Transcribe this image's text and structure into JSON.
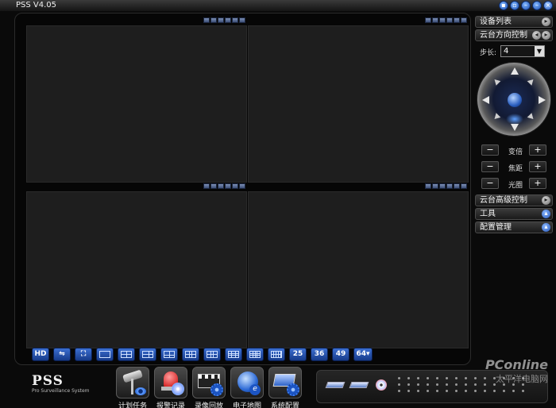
{
  "window": {
    "title": "PSS V4.05"
  },
  "layout_buttons": [
    "HD",
    "",
    "",
    "",
    "",
    "",
    "",
    "",
    "",
    "",
    "",
    "",
    "25",
    "36",
    "49",
    "64▾"
  ],
  "right_panel": {
    "device_list": "设备列表",
    "ptz_control": "云台方向控制",
    "step_label": "步长:",
    "step_value": "4",
    "adjust": [
      {
        "name": "变倍",
        "minus": "−",
        "plus": "+"
      },
      {
        "name": "焦距",
        "minus": "−",
        "plus": "+"
      },
      {
        "name": "光圈",
        "minus": "−",
        "plus": "+"
      }
    ],
    "ptz_advanced": "云台高级控制",
    "tools": "工具",
    "config_manage": "配置管理"
  },
  "logo": {
    "name": "PSS",
    "subtitle": "Pro Surveillance System"
  },
  "bottom_tools": [
    {
      "label": "计划任务",
      "icon": "camera-schedule-icon"
    },
    {
      "label": "报警记录",
      "icon": "alarm-siren-icon"
    },
    {
      "label": "录像回放",
      "icon": "video-playback-icon"
    },
    {
      "label": "电子地图",
      "icon": "emap-globe-icon"
    },
    {
      "label": "系统配置",
      "icon": "system-config-icon"
    }
  ],
  "watermark": {
    "brand": "PConline",
    "sub": "太平洋电脑网"
  }
}
